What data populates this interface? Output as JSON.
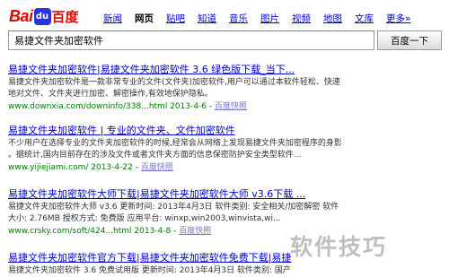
{
  "logo": {
    "bai": "Bai",
    "paw": "du",
    "baidu": "百度"
  },
  "nav": {
    "items": [
      "新闻",
      "网页",
      "贴吧",
      "知道",
      "音乐",
      "图片",
      "视频",
      "地图",
      "文库",
      "更多»"
    ]
  },
  "search": {
    "value": "易捷文件夹加密软件",
    "button_label": "百度一下"
  },
  "results": [
    {
      "title": "易捷文件夹加密软件|易捷文件夹加密软件 3.6 绿色版下载_当下...",
      "desc_lines": [
        "易捷文件夹加密软件是一款非常专业的文件(文件夹)加密软件,用户可以通过本软件轻松、快速",
        "地对文件、文件夹进行加密、解密操作,有效地保护隐私。"
      ],
      "url": "www.downxia.com/downinfo/338...html 2013-4-6",
      "snapshot": "百度快照"
    },
    {
      "title": "易捷文件夹加密软件 | 专业的文件夹、文件加密软件",
      "desc_lines": [
        "不少用户在选择专业的文件夹加密软件的时候,经常会从网络上发现易捷文件夹加密程序的身影",
        "。据统计,国内目前存在的涉及文件或者文件夹方面的信息保密防护安全类型软件..."
      ],
      "url": "www.yijiejiami.com/ 2013-4-22",
      "snapshot": "百度快照"
    },
    {
      "title": "易捷文件夹加密软件大师下载|易捷文件夹加密软件大师 v3.6下载 ...",
      "desc_lines": [
        "易捷文件夹加密软件大师 v3.6 更新时间: 2013年4月3日 软件类别: 安全相关/加密解密 软件",
        "大小: 2.76MB 授权方式: 免费版 应用平台: winxp,win2003,winvista,wi..."
      ],
      "url": "www.crsky.com/soft/424...html 2013-4-8",
      "snapshot": "百度快照"
    },
    {
      "title": "易捷文件夹加密软件官方下载|易捷文件夹加密软件免费下载|易捷",
      "desc_lines": [
        "易捷文件夹加密软件 3.6 免费试用版 更新时间: 2013年4月3日 软件类别: 国产"
      ]
    }
  ],
  "watermark": "软件技巧"
}
